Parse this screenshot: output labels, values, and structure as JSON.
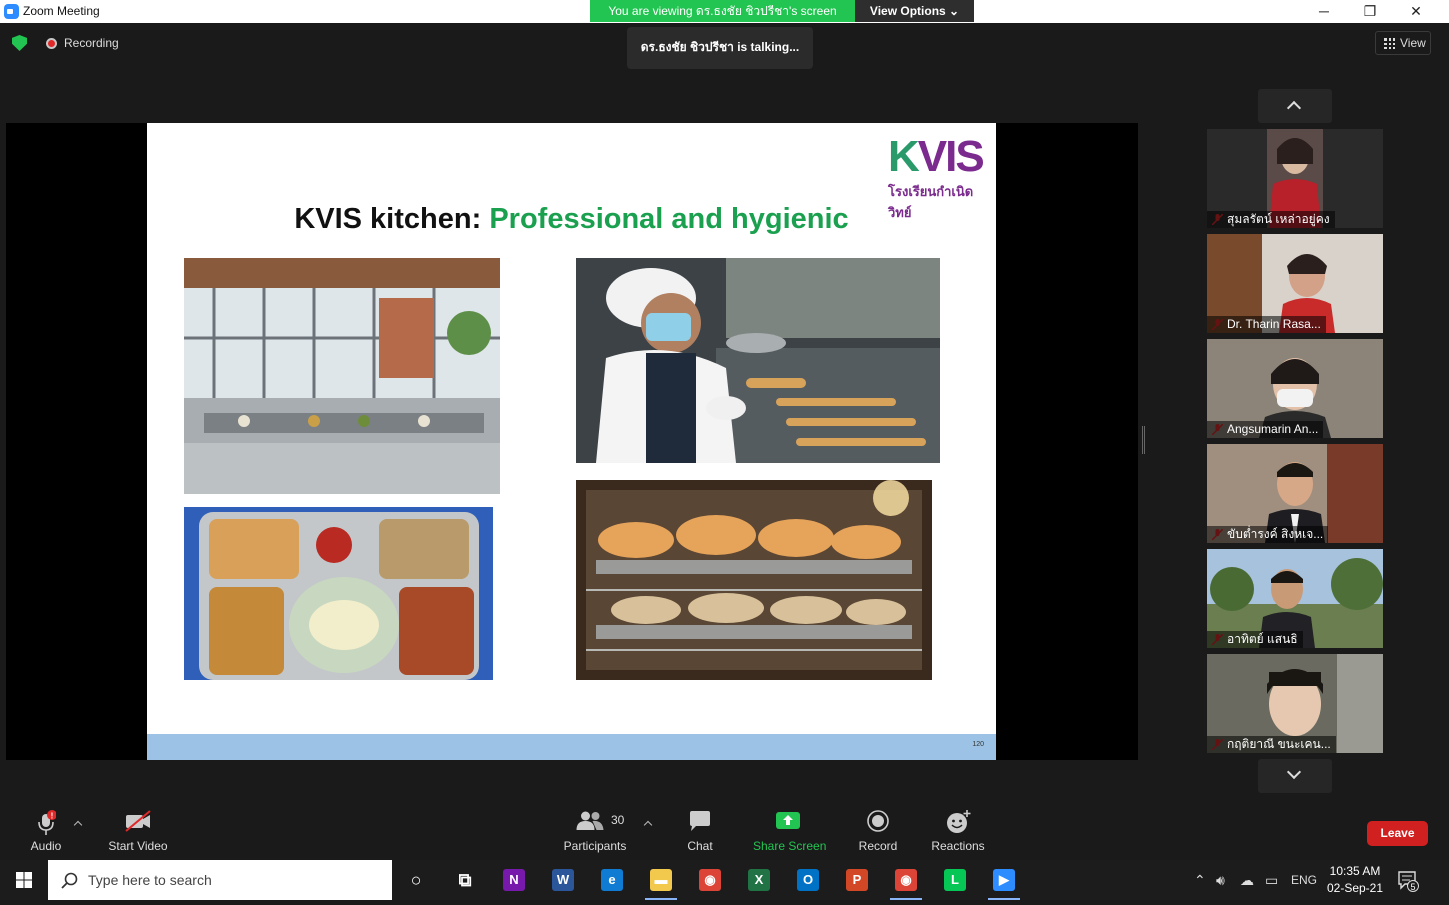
{
  "window": {
    "title": "Zoom Meeting",
    "viewing_banner": "You are viewing ดร.ธงชัย ชิวปรีชา's screen",
    "view_options": "View Options ⌄",
    "minimize": "─",
    "maximize": "❐",
    "close": "✕"
  },
  "meeting": {
    "recording_label": "Recording",
    "talking": "ดร.ธงชัย ชิวปรีชา is  talking...",
    "view_label": "View"
  },
  "slide": {
    "logo_text": "KVIS",
    "logo_sub": "โรงเรียนกำเนิดวิทย์",
    "title_black": "KVIS kitchen: ",
    "title_green": "Professional and hygienic",
    "page_number": "120"
  },
  "participants": [
    {
      "name": "สุมลรัตน์ เหล่าอยู่คง",
      "bg": "#5a4a48"
    },
    {
      "name": "Dr. Tharin Rasa...",
      "bg": "#c9c2bc"
    },
    {
      "name": "Angsumarin An...",
      "bg": "#7a7268"
    },
    {
      "name": "ขับต่ำรงค์  สิงหเจ...",
      "bg": "#9a8a7c"
    },
    {
      "name": "อาทิตย์ แสนธิ",
      "bg": "#5f7a52"
    },
    {
      "name": "กฤติยาณี ขนะเคน...",
      "bg": "#6a6a60"
    }
  ],
  "toolbar": {
    "audio": "Audio",
    "start_video": "Start Video",
    "participants": "Participants",
    "participants_count": "30",
    "chat": "Chat",
    "share_screen": "Share Screen",
    "record": "Record",
    "reactions": "Reactions",
    "leave": "Leave",
    "audio_badge": "!"
  },
  "taskbar": {
    "search_placeholder": "Type here to search",
    "language": "ENG",
    "time": "10:35 AM",
    "date": "02-Sep-21",
    "notifications": "5",
    "apps": [
      {
        "name": "cortana",
        "glyph": "○",
        "color": "transparent"
      },
      {
        "name": "task-view",
        "glyph": "⧉",
        "color": "transparent"
      },
      {
        "name": "onenote",
        "glyph": "N",
        "color": "#7719aa"
      },
      {
        "name": "word",
        "glyph": "W",
        "color": "#2b579a"
      },
      {
        "name": "edge",
        "glyph": "e",
        "color": "#0f7bd3"
      },
      {
        "name": "file-explorer",
        "glyph": "▬",
        "color": "#f2c94c"
      },
      {
        "name": "chrome",
        "glyph": "◉",
        "color": "#db4437"
      },
      {
        "name": "excel",
        "glyph": "X",
        "color": "#217346"
      },
      {
        "name": "outlook",
        "glyph": "O",
        "color": "#0072c6"
      },
      {
        "name": "powerpoint",
        "glyph": "P",
        "color": "#d24726"
      },
      {
        "name": "chrome-profile",
        "glyph": "◉",
        "color": "#db4437"
      },
      {
        "name": "line",
        "glyph": "L",
        "color": "#06c755"
      },
      {
        "name": "zoom",
        "glyph": "▶",
        "color": "#2d8cff"
      }
    ]
  }
}
